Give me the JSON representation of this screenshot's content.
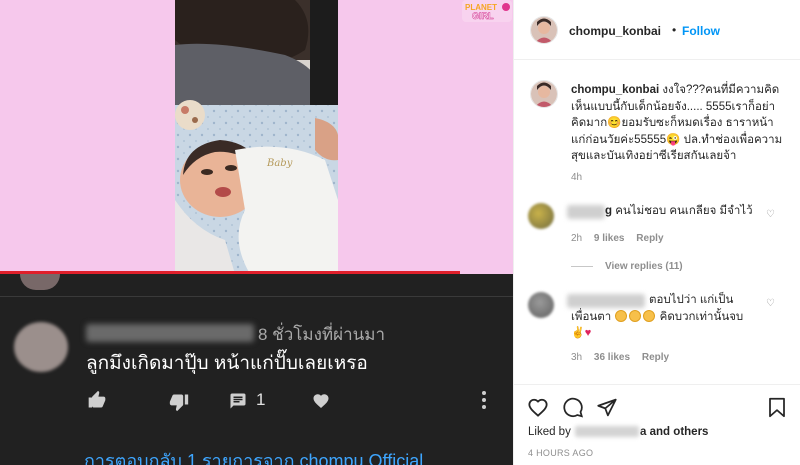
{
  "media": {
    "sticker_text": "PLANET GIRL",
    "youtube_comment": {
      "time": "8 ชั่วโมงที่ผ่านมา",
      "text": "ลูกมึงเกิดมาปุ๊บ หน้าแก่ปั๊บเลยเหรอ",
      "like_count": "1",
      "replies_link": "การตอบกลับ 1 รายการจาก chompu Official"
    },
    "onesie_print": "Baby"
  },
  "instagram": {
    "username": "chompu_konbai",
    "dot": "•",
    "follow_label": "Follow",
    "caption": {
      "username": "chompu_konbai",
      "text": "งงใจ???คนที่มีความคิดเห็นแบบนี้กับเด็กน้อยจัง..... 5555เราก็อย่าคิดมาก😊ยอมรับซะก็หมดเรื่อง ธาราหน้าแก่ก่อนวัยค่ะ55555😜 ปล.ทำช่องเพื่อความสุขและบันเทิงอย่าซีเรียสกันเลยจ้า",
      "age": "4h"
    },
    "comments": [
      {
        "name_suffix": "g",
        "text": "คนไม่ชอบ คนเกลียจ มีจำไว้",
        "age": "2h",
        "likes": "9 likes",
        "reply": "Reply"
      },
      {
        "text_line1": "ตอบไปว่า แก่เป็น",
        "text_line2": "เพื่อนตา",
        "text_line2_end": "คิดบวกเท่านั้นจบ",
        "age": "3h",
        "likes": "36 likes",
        "reply": "Reply"
      }
    ],
    "view_replies": "View replies (11)",
    "liked_by_prefix": "Liked by",
    "liked_by_suffix": "a and",
    "liked_by_others": "others",
    "post_age": "4 HOURS AGO"
  },
  "colors": {
    "pink_bg": "#f6c8ec",
    "progress_red": "#e01f2b",
    "youtube_bg": "#212121",
    "youtube_link": "#3ea6ff",
    "follow_blue": "#0095f6"
  },
  "icons": [
    "thumbs-up-icon",
    "thumbs-down-icon",
    "comment-icon",
    "heart-icon",
    "more-vert-icon",
    "ig-heart-icon",
    "ig-comment-icon",
    "ig-share-icon",
    "ig-bookmark-icon"
  ]
}
